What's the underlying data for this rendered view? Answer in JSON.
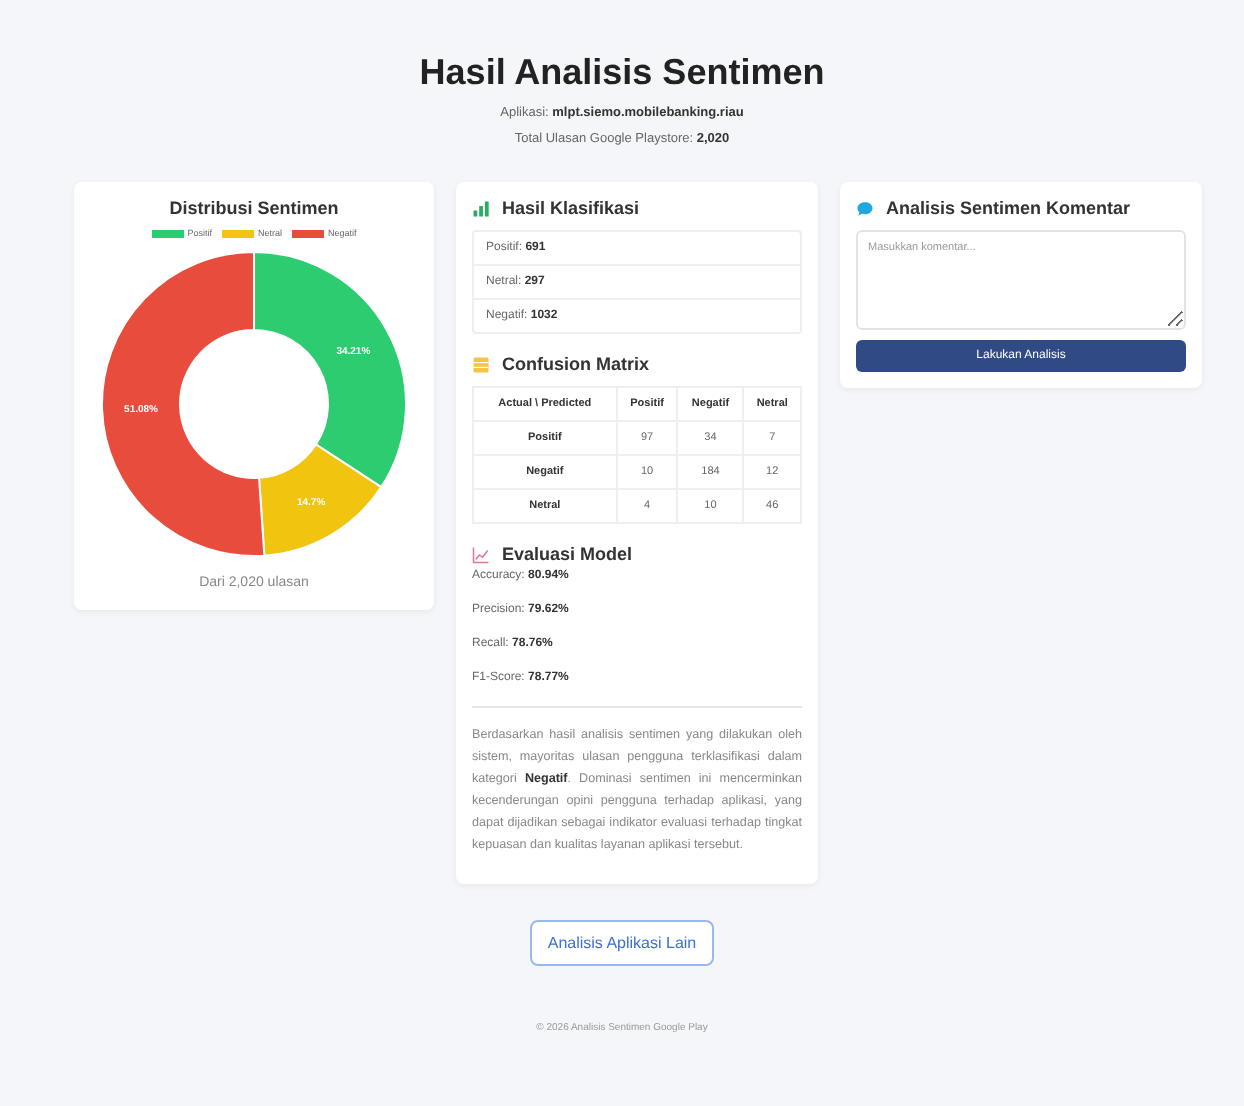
{
  "header": {
    "title": "Hasil Analisis Sentimen",
    "app_label": "Aplikasi:",
    "app_id": "mlpt.siemo.mobilebanking.riau",
    "total_label": "Total Ulasan Google Playstore:",
    "total_value": "2,020"
  },
  "distribution": {
    "title": "Distribusi Sentimen",
    "footer": "Dari 2,020 ulasan",
    "chart_data": {
      "type": "donut",
      "categories": [
        "Positif",
        "Netral",
        "Negatif"
      ],
      "values": [
        34.21,
        14.7,
        51.08
      ],
      "colors": [
        "#2ecc71",
        "#f1c40f",
        "#e74c3c"
      ],
      "data_labels": true,
      "value_labels": [
        "34.21%",
        "14.7%",
        "51.08%"
      ]
    }
  },
  "classification": {
    "title": "Hasil Klasifikasi",
    "items": [
      {
        "label": "Positif:",
        "value": "691"
      },
      {
        "label": "Netral:",
        "value": "297"
      },
      {
        "label": "Negatif:",
        "value": "1032"
      }
    ]
  },
  "confusion": {
    "title": "Confusion Matrix",
    "columns": [
      "Actual \\ Predicted",
      "Positif",
      "Negatif",
      "Netral"
    ],
    "rows": [
      [
        "Positif",
        "97",
        "34",
        "7"
      ],
      [
        "Negatif",
        "10",
        "184",
        "12"
      ],
      [
        "Netral",
        "4",
        "10",
        "46"
      ]
    ]
  },
  "evaluation": {
    "title": "Evaluasi Model",
    "metrics": [
      {
        "label": "Accuracy:",
        "value": "80.94%"
      },
      {
        "label": "Precision:",
        "value": "79.62%"
      },
      {
        "label": "Recall:",
        "value": "78.76%"
      },
      {
        "label": "F1-Score:",
        "value": "78.77%"
      }
    ],
    "summary": "Berdasarkan hasil analisis sentimen yang dilakukan oleh sistem, mayoritas ulasan pengguna terklasifikasi dalam kategori **Negatif**. Dominasi sentimen ini mencerminkan kecenderungan opini pengguna terhadap aplikasi, yang dapat dijadikan sebagai indikator evaluasi terhadap tingkat kepuasan dan kualitas layanan aplikasi tersebut."
  },
  "comment": {
    "title": "Analisis Sentimen Komentar",
    "placeholder": "Masukkan komentar...",
    "button": "Lakukan Analisis"
  },
  "other_button": "Analisis Aplikasi Lain",
  "footer": "© 2026 Analisis Sentimen Google Play"
}
